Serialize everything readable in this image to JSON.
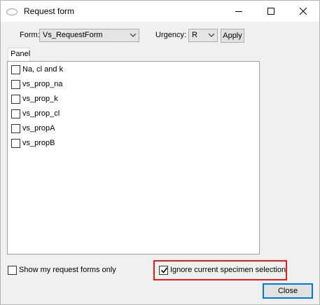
{
  "window": {
    "title": "Request form"
  },
  "toolbar": {
    "form_label": "Form:",
    "form_value": "Vs_RequestForm",
    "urgency_label": "Urgency:",
    "urgency_value": "R",
    "apply_label": "Apply"
  },
  "panel": {
    "tab_label": "Panel",
    "items": [
      {
        "label": "Na, cl and k",
        "checked": false
      },
      {
        "label": "vs_prop_na",
        "checked": false
      },
      {
        "label": "vs_prop_k",
        "checked": false
      },
      {
        "label": "vs_prop_cl",
        "checked": false
      },
      {
        "label": "vs_propA",
        "checked": false
      },
      {
        "label": "vs_propB",
        "checked": false
      }
    ]
  },
  "options": {
    "show_my_forms_label": "Show my request forms only",
    "show_my_forms_checked": false,
    "ignore_selection_label": "Ignore current specimen selection",
    "ignore_selection_checked": true
  },
  "footer": {
    "close_label": "Close"
  },
  "colors": {
    "highlight": "#e0201b",
    "focus_border": "#0078d7"
  },
  "icons": {
    "app": "app-icon",
    "minimize": "minimize-icon",
    "maximize": "maximize-icon",
    "close": "close-icon",
    "dropdown": "chevron-down-icon",
    "check": "checkmark-icon"
  }
}
